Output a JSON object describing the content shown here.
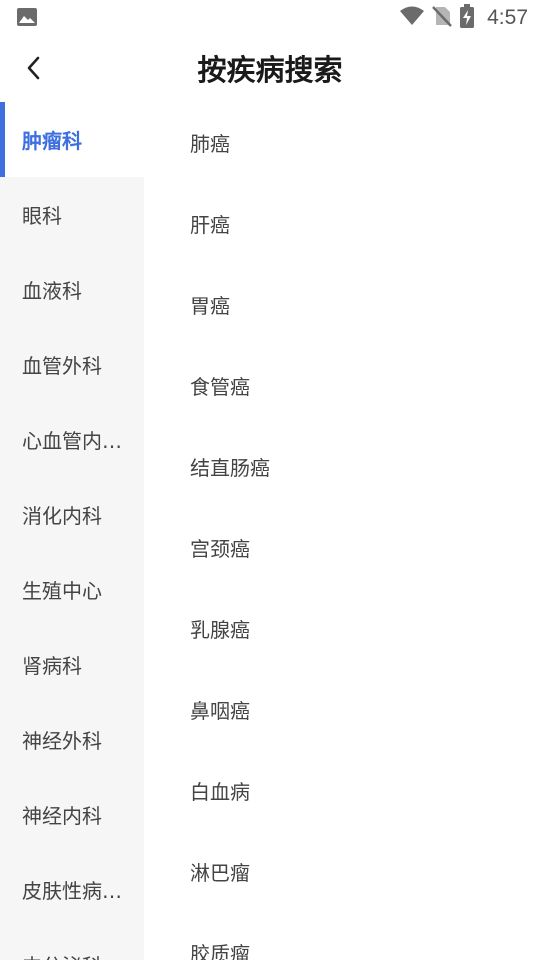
{
  "status_bar": {
    "time": "4:57",
    "icons": [
      "gallery-icon",
      "wifi-icon",
      "no-sim-icon",
      "battery-charging-icon"
    ]
  },
  "header": {
    "title": "按疾病搜索",
    "back_icon": "chevron-left-icon"
  },
  "sidebar": {
    "items": [
      {
        "label": "肿瘤科",
        "active": true
      },
      {
        "label": "眼科",
        "active": false
      },
      {
        "label": "血液科",
        "active": false
      },
      {
        "label": "血管外科",
        "active": false
      },
      {
        "label": "心血管内…",
        "active": false
      },
      {
        "label": "消化内科",
        "active": false
      },
      {
        "label": "生殖中心",
        "active": false
      },
      {
        "label": "肾病科",
        "active": false
      },
      {
        "label": "神经外科",
        "active": false
      },
      {
        "label": "神经内科",
        "active": false
      },
      {
        "label": "皮肤性病…",
        "active": false
      },
      {
        "label": "内分泌科",
        "active": false
      }
    ]
  },
  "diseases": {
    "items": [
      {
        "label": "肺癌"
      },
      {
        "label": "肝癌"
      },
      {
        "label": "胃癌"
      },
      {
        "label": "食管癌"
      },
      {
        "label": "结直肠癌"
      },
      {
        "label": "宫颈癌"
      },
      {
        "label": "乳腺癌"
      },
      {
        "label": "鼻咽癌"
      },
      {
        "label": "白血病"
      },
      {
        "label": "淋巴瘤"
      },
      {
        "label": "胶质瘤"
      }
    ]
  },
  "colors": {
    "accent": "#3d6fe0",
    "sidebar_bg": "#f6f6f6",
    "text": "#444444"
  }
}
